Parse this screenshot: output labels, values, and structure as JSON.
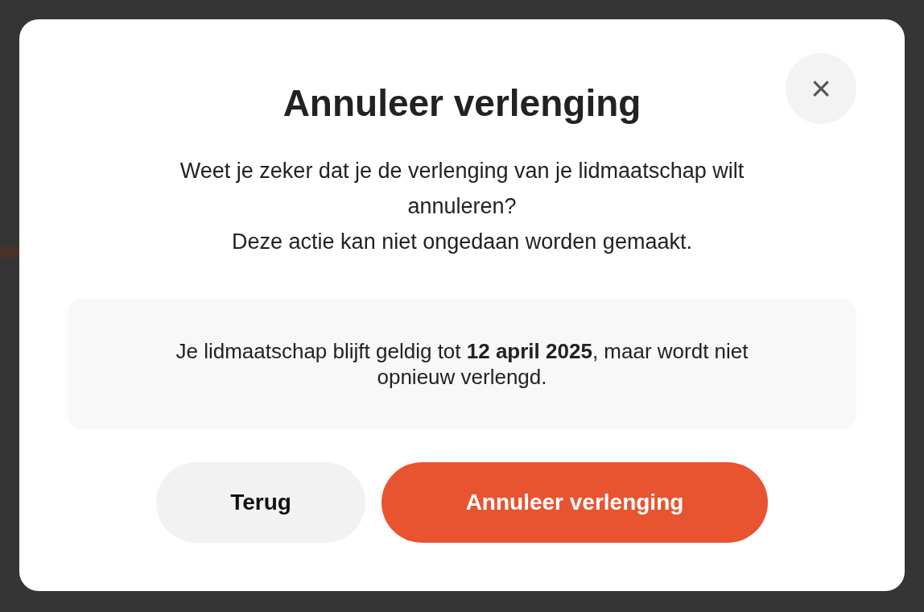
{
  "dialog": {
    "title": "Annuleer verlenging",
    "close_label": "×",
    "message": [
      "Weet je zeker dat je de verlenging van je lidmaatschap wilt annuleren?",
      "Deze actie kan niet ongedaan worden gemaakt."
    ],
    "notice": "Je lidmaatschap blijft geldig tot **12 april 2025**, maar wordt niet opnieuw verlengd.",
    "buttons": [
      {
        "label": "Terug",
        "kind": "secondary"
      },
      {
        "label": "Annuleer verlenging",
        "kind": "primary"
      }
    ]
  }
}
